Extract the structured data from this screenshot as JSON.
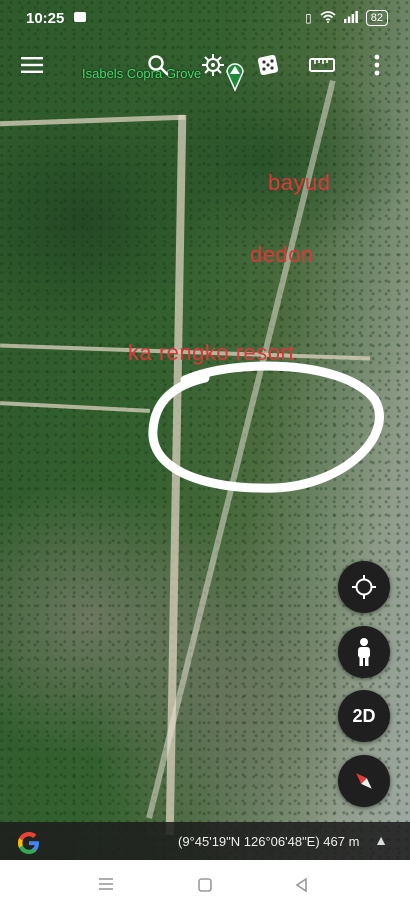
{
  "status_bar": {
    "time": "10:25",
    "battery": "82"
  },
  "toolbar": {
    "place_label": "Isabels Copra Grove",
    "icons": [
      "menu-icon",
      "search-icon",
      "voyager-wheel-icon",
      "dice-icon",
      "ruler-icon",
      "more-vert-icon"
    ]
  },
  "map_labels": {
    "bayud": "bayud",
    "dedon": "dedon",
    "resort": "ka rengko resort"
  },
  "fab": {
    "two_d": "2D"
  },
  "info_bar": {
    "coordinates": "(9°45'19\"N 126°06'48\"E) 467 m"
  },
  "colors": {
    "overlay_text": "#e0363b",
    "place_label": "#3fdd6a",
    "circle": "#ffffff",
    "fab_bg": "#1f1f1f"
  }
}
